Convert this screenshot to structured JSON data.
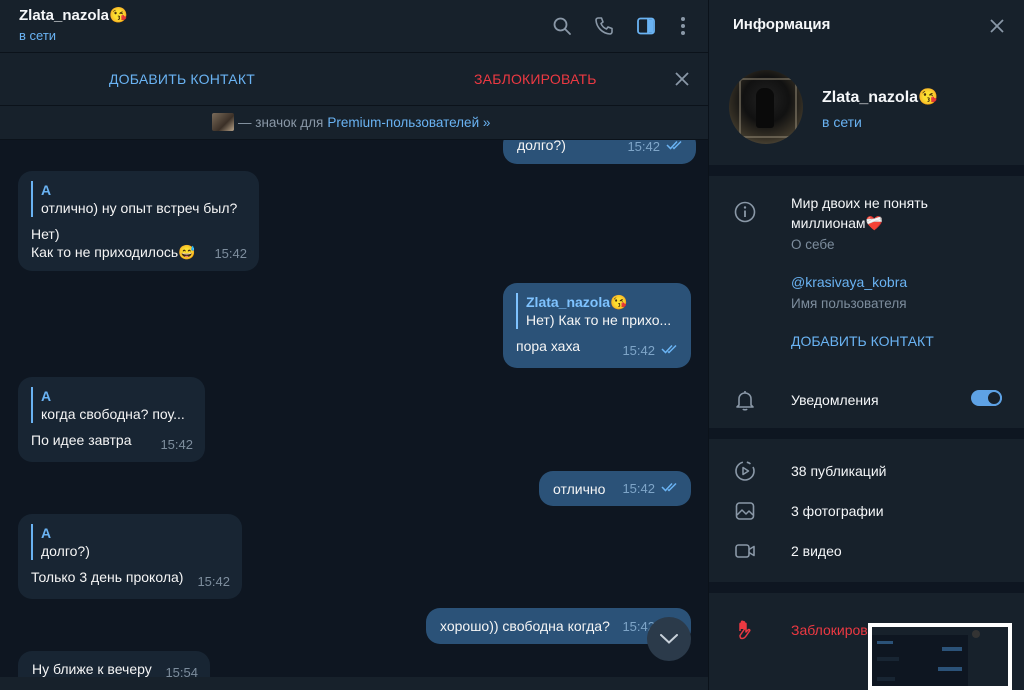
{
  "chat": {
    "title": "Zlata_nazola😘",
    "status": "в сети",
    "actions": {
      "add_contact": "ДОБАВИТЬ КОНТАКТ",
      "block": "ЗАБЛОКИРОВАТЬ"
    },
    "premium": {
      "text": "— значок для",
      "link": "Premium-пользователей »"
    }
  },
  "messages": [
    {
      "dir": "out",
      "text": "долго?)",
      "time": "15:42"
    },
    {
      "dir": "in",
      "reply_name": "А",
      "reply_text": "отлично) ну опыт встреч был?",
      "text1": "Нет)",
      "text2": "Как то не приходилось😅",
      "time": "15:42"
    },
    {
      "dir": "out",
      "reply_name": "Zlata_nazola😘",
      "reply_text": "Нет)  Как то не прихо...",
      "text": "пора хаха",
      "time": "15:42"
    },
    {
      "dir": "in",
      "reply_name": "А",
      "reply_text": "когда свободна? поу...",
      "text": "По идее завтра",
      "time": "15:42"
    },
    {
      "dir": "out",
      "text": "отлично",
      "time": "15:42"
    },
    {
      "dir": "in",
      "reply_name": "А",
      "reply_text": "долго?)",
      "text": "Только 3 день прокола)",
      "time": "15:42"
    },
    {
      "dir": "out",
      "text": "хорошо)) свободна когда?",
      "time": "15:42"
    },
    {
      "dir": "in",
      "text": "Ну ближе к вечеру",
      "time": "15:54"
    }
  ],
  "info": {
    "title": "Информация",
    "name": "Zlata_nazola😘",
    "status": "в сети",
    "bio_line1": "Мир двоих не понять",
    "bio_line2": "миллионам❤️‍🩹",
    "bio_label": "О себе",
    "username": "@krasivaya_kobra",
    "username_label": "Имя пользователя",
    "add_contact": "ДОБАВИТЬ КОНТАКТ",
    "notifications": "Уведомления",
    "notifications_on": true,
    "publications": "38 публикаций",
    "photos": "3 фотографии",
    "videos": "2 видео",
    "block": "Заблокировать"
  },
  "colors": {
    "accent": "#6ab3f3",
    "danger": "#ec3942",
    "bg": "#0e1621",
    "panel": "#17212b",
    "out_bubble": "#2b5278",
    "in_bubble": "#182533"
  }
}
